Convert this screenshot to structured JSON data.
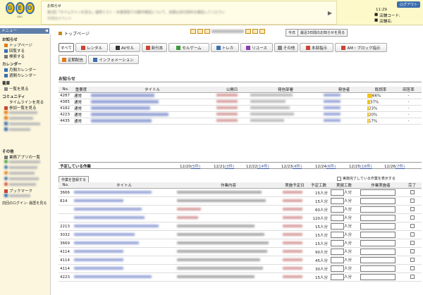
{
  "header": {
    "logo_letters": [
      "G",
      "E",
      "O"
    ],
    "logo_sub": "GEO",
    "notice_lines": [
      "お知らせ",
      "第2回「タイムラインを見る」連携テスト・本番環境での動作確認について、詳細は添付資料を確認してください",
      "今月のイベント"
    ],
    "logout": "ログアウト",
    "time": "11:29",
    "store_code_label": "店舗コード:",
    "store_name_label": "店舗名:",
    "store_code": "",
    "store_name": ""
  },
  "sidebar": {
    "menu_title": "メニュー",
    "sections": [
      {
        "title": "お知らせ",
        "items": [
          "トップページ",
          "回覧する",
          "検索する"
        ]
      },
      {
        "title": "カレンダー",
        "items": [
          "月間カレンダー",
          "週間カレンダー"
        ]
      },
      {
        "title": "書庫",
        "items": [
          "一覧を見る"
        ]
      },
      {
        "title": "コミュニティ",
        "items": [
          "タイムラインを見る",
          "参加一覧を見る",
          "",
          "",
          "",
          ""
        ]
      },
      {
        "title": "その他",
        "items": [
          "業務アプリの一覧",
          "",
          "",
          "",
          "",
          ""
        ]
      },
      {
        "title": "",
        "items": [
          "ブックマーク",
          ""
        ]
      }
    ],
    "footer": "前回のログイン: 履歴を見る"
  },
  "main": {
    "breadcrumb": "トップページ",
    "today_btn": "今日",
    "recent_btn": "最近3日間のお知らせを見る",
    "tabs": [
      "すべて",
      "レンタル",
      "AVセル",
      "新刊本",
      "セルゲーム",
      "トレカ",
      "リユース",
      "その他",
      "本部指示",
      "AM・ブロック指示",
      "定期配信",
      "インフォメーション"
    ],
    "news_title": "お知らせ",
    "news_headers": [
      "No.",
      "重要度",
      "タイトル",
      "公開日",
      "発信部署",
      "発信者",
      "既読率",
      "回答率"
    ],
    "news_rows": [
      {
        "no": "4287",
        "level": "通常",
        "pct": "66%",
        "ans": "-",
        "pv": 66
      },
      {
        "no": "4385",
        "level": "通常",
        "pct": "37%",
        "ans": "-",
        "pv": 37
      },
      {
        "no": "4182",
        "level": "通常",
        "pct": "23%",
        "ans": "-",
        "pv": 23
      },
      {
        "no": "4223",
        "level": "通常",
        "pct": "20%",
        "ans": "-",
        "pv": 20
      },
      {
        "no": "4435",
        "level": "通常",
        "pct": "17%",
        "ans": "-",
        "pv": 17
      }
    ],
    "schedule_label": "予定している作業",
    "schedule_days": [
      {
        "date": "12/20",
        "count": "(5件)"
      },
      {
        "date": "12/21",
        "count": "(3件)"
      },
      {
        "date": "12/22",
        "count": "(14件)"
      },
      {
        "date": "12/23",
        "count": "(4件)"
      },
      {
        "date": "12/24",
        "count": "(6件)"
      },
      {
        "date": "12/25",
        "count": "(16件)"
      },
      {
        "date": "12/26",
        "count": "(7件)"
      }
    ],
    "add_task_btn": "作業を登録する",
    "show_done_label": "実施完了している作業を表示する",
    "task_headers": [
      "No.",
      "タイトル",
      "作業内容",
      "実施予定日",
      "予定工数",
      "実績工数",
      "作業実施者",
      "完了"
    ],
    "task_rows": [
      {
        "no": "3666",
        "plan": "15人分",
        "unit": "人分"
      },
      {
        "no": "814",
        "plan": "15人分",
        "unit": "人分"
      },
      {
        "no": "",
        "plan": "60人分",
        "unit": "人分"
      },
      {
        "no": "",
        "plan": "120人分",
        "unit": "人分"
      },
      {
        "no": "2213",
        "plan": "15人分",
        "unit": "人分"
      },
      {
        "no": "3032",
        "plan": "15人分",
        "unit": "人分"
      },
      {
        "no": "3669",
        "plan": "15人分",
        "unit": "人分"
      },
      {
        "no": "4114",
        "plan": "90人分",
        "unit": "人分"
      },
      {
        "no": "4114",
        "plan": "45人分",
        "unit": "人分"
      },
      {
        "no": "4114",
        "plan": "30人分",
        "unit": "人分"
      },
      {
        "no": "4223",
        "plan": "15人分",
        "unit": "人分"
      }
    ]
  },
  "colors": {
    "accent": "#3a6fb0",
    "header_bg": "#fdf9c8",
    "sidebar_bg": "#fbf6dd",
    "bar": "#f3c21a"
  }
}
